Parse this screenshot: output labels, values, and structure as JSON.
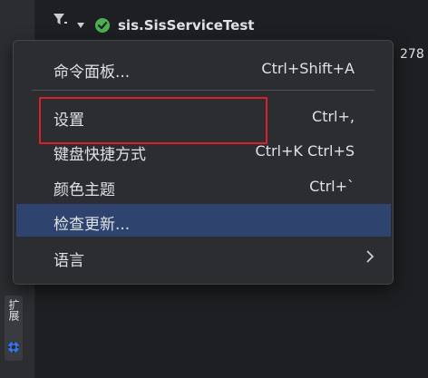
{
  "side_panel": {
    "tab_label": "扩展"
  },
  "test_tree": {
    "root_label": "sis.SisServiceTest",
    "status": "passed",
    "status_color": "#4caf50"
  },
  "right_value": "278",
  "menu": {
    "items": [
      {
        "label": "命令面板...",
        "shortcut": "Ctrl+Shift+A"
      },
      {
        "label": "设置",
        "shortcut": "Ctrl+,"
      },
      {
        "label": "键盘快捷方式",
        "shortcut": "Ctrl+K Ctrl+S"
      },
      {
        "label": "颜色主题",
        "shortcut": "Ctrl+`"
      },
      {
        "label": "检查更新...",
        "shortcut": ""
      },
      {
        "label": "语言",
        "shortcut": ""
      }
    ],
    "selected_index": 4,
    "selected_color": "#2e436e",
    "annotation_color": "#d7202a"
  }
}
